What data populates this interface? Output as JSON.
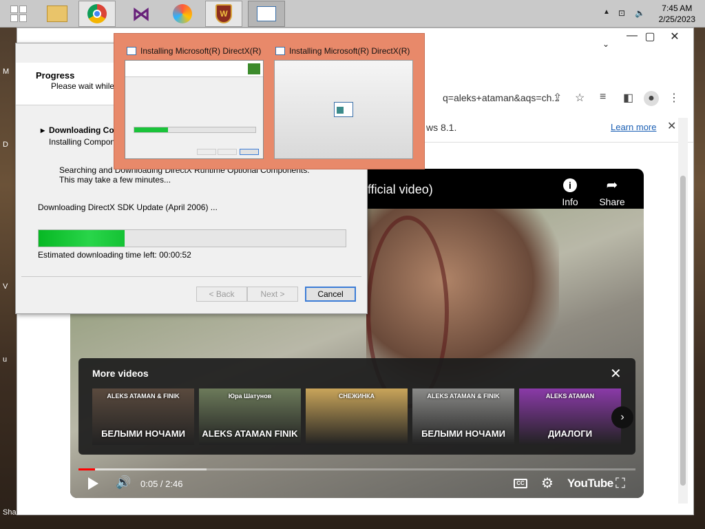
{
  "taskbar": {
    "clock_time": "7:45 AM",
    "clock_date": "2/25/2023",
    "apps": [
      "windows-start",
      "file-explorer",
      "google-chrome",
      "visual-studio",
      "browser-2",
      "shield-app",
      "installer-window"
    ]
  },
  "installer": {
    "header_title": "Progress",
    "header_subtitle": "Please wait while Setup completes the following actions",
    "step_heading": "Downloading Components",
    "step_sub": "Installing Components",
    "detail_line1": "Searching and Downloading DirectX Runtime Optional Components.",
    "detail_line2": "This may take a few minutes...",
    "status": "Downloading DirectX SDK Update (April 2006) ...",
    "progress_fraction": 0.28,
    "eta": "Estimated downloading time left: 00:00:52",
    "back_label": "< Back",
    "next_label": "Next >",
    "cancel_label": "Cancel"
  },
  "preview": {
    "title1": "Installing Microsoft(R) DirectX(R)",
    "title2": "Installing Microsoft(R) DirectX(R)"
  },
  "browser": {
    "url_text": "q=aleks+ataman&aqs=ch...",
    "infobar_text": "ws 8.1.",
    "learn_more": "Learn more"
  },
  "video": {
    "title": "fficial video)",
    "info_label": "Info",
    "share_label": "Share",
    "more_videos_title": "More videos",
    "thumbs": [
      {
        "caption": "БЕЛЫМИ НОЧАМИ",
        "top_text": "ALEKS ATAMAN & FINIK",
        "color": "#5a4a3e"
      },
      {
        "caption": "ALEKS ATAMAN FINIK",
        "top_text": "Юра Шатунов",
        "color": "#6c7a5a"
      },
      {
        "caption": "",
        "top_text": "СНЕЖИНКА",
        "color": "#c9a55a"
      },
      {
        "caption": "БЕЛЫМИ НОЧАМИ",
        "top_text": "ALEKS ATAMAN & FINIK",
        "color": "#8a8a88"
      },
      {
        "caption": "ДИАЛОГИ",
        "top_text": "ALEKS ATAMAN",
        "color": "#8a3aa8"
      }
    ],
    "time": "0:05 / 2:46",
    "played_fraction": 0.03,
    "loaded_fraction": 0.23,
    "brand": "YouTube"
  },
  "desktop": {
    "bottom_text": "Shark Grabb..."
  },
  "colors": {
    "preview_bg": "#e8896a",
    "progress_green": "#1ac33a",
    "youtube_red": "#ff0000"
  }
}
